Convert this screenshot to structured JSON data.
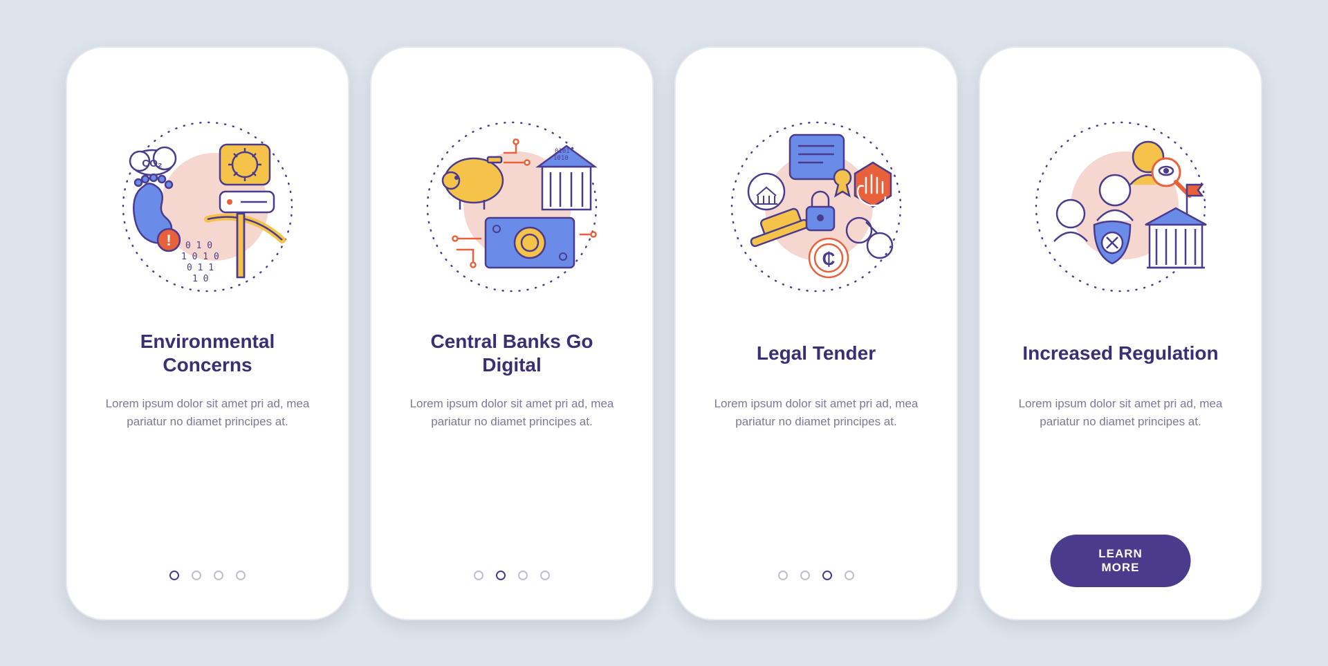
{
  "colors": {
    "purple": "#4a3b8d",
    "purple_line": "#3b2e74",
    "text_muted": "#7e7795",
    "yellow": "#f5c24a",
    "orange": "#e8613b",
    "blue": "#6b8be8",
    "pink": "#f6d7d0"
  },
  "screens": [
    {
      "id": "environmental",
      "title": "Environmental Concerns",
      "desc": "Lorem ipsum dolor sit amet pri ad, mea pariatur no diamet principes at.",
      "active_dot": 0,
      "cta": null
    },
    {
      "id": "central-banks",
      "title": "Central Banks Go Digital",
      "desc": "Lorem ipsum dolor sit amet pri ad, mea pariatur no diamet principes at.",
      "active_dot": 1,
      "cta": null
    },
    {
      "id": "legal-tender",
      "title": "Legal Tender",
      "desc": "Lorem ipsum dolor sit amet pri ad, mea pariatur no diamet principes at.",
      "active_dot": 2,
      "cta": null
    },
    {
      "id": "regulation",
      "title": "Increased Regulation",
      "desc": "Lorem ipsum dolor sit amet pri ad, mea pariatur no diamet principes at.",
      "active_dot": 3,
      "cta": "LEARN MORE"
    }
  ]
}
